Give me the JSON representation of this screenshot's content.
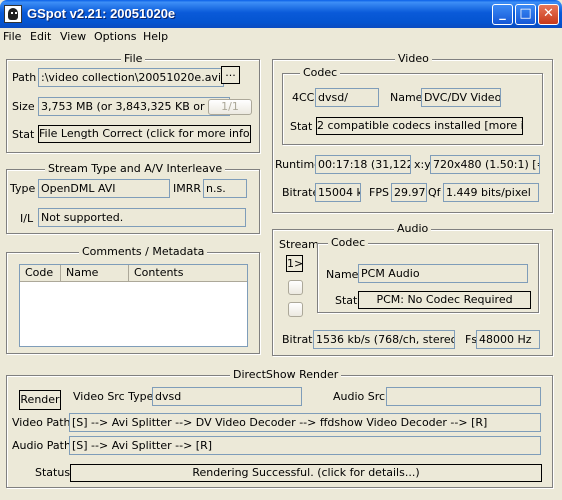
{
  "window": {
    "title": "GSpot v2.21: 20051020e",
    "minimize": "_",
    "maximize": "□",
    "close": "✕"
  },
  "menu": [
    "File",
    "Edit",
    "View",
    "Options",
    "Help"
  ],
  "file": {
    "title": "File",
    "path_label": "Path",
    "path_value": ":\\video collection\\20051020e.avi",
    "browse_label": "...",
    "size_label": "Size",
    "size_value": "3,753 MB (or 3,843,325 KB or 3,9",
    "size_button": "1/1",
    "stat_label": "Stat",
    "stat_button": "File Length Correct (click for more info...)"
  },
  "stream": {
    "title": "Stream Type and A/V Interleave",
    "type_label": "Type",
    "type_value": "OpenDML AVI",
    "imrr_label": "IMRR",
    "imrr_value": "n.s.",
    "il_label": "I/L",
    "il_value": "Not supported."
  },
  "comments": {
    "title": "Comments / Metadata",
    "columns": [
      "Code",
      "Name",
      "Contents"
    ]
  },
  "video": {
    "title": "Video",
    "codec_title": "Codec",
    "fourcc_label": "4CC",
    "fourcc_value": "dvsd/",
    "name_label": "Name",
    "name_value": "DVC/DV Video",
    "stat_label": "Stat",
    "stat_button": "2 compatible codecs installed [more info...]",
    "runtime_label": "Runtime",
    "runtime_value": "00:17:18 (31,122 fr",
    "xy_label": "x:y",
    "xy_value": "720x480 (1.50:1) [=3:",
    "bitrate_label": "Bitrate",
    "bitrate_value": "15004 k",
    "fps_label": "FPS",
    "fps_value": "29.97",
    "qf_label": "Qf",
    "qf_value": "1.449 bits/pixel"
  },
  "audio": {
    "title": "Audio",
    "stream_label": "Stream",
    "stream_buttons": [
      "1>",
      "",
      ""
    ],
    "codec_title": "Codec",
    "name_label": "Name",
    "name_value": "PCM Audio",
    "stat_label": "Stat",
    "stat_button": "PCM: No Codec Required",
    "bitrate_label": "Bitrate",
    "bitrate_value": "1536 kb/s (768/ch, stereo)",
    "fs_label": "Fs",
    "fs_value": "48000 Hz"
  },
  "directshow": {
    "title": "DirectShow Render",
    "render_button": "Render",
    "video_src_label": "Video Src Type",
    "video_src_value": "dvsd",
    "audio_src_label": "Audio Src",
    "audio_src_value": "",
    "video_path_label": "Video Path",
    "video_path_value": "[S] --> Avi Splitter --> DV Video Decoder --> ffdshow Video Decoder --> [R]",
    "audio_path_label": "Audio Path",
    "audio_path_value": "[S] --> Avi Splitter --> [R]",
    "status_label": "Status",
    "status_button": "Rendering Successful.  (click for details...)"
  }
}
